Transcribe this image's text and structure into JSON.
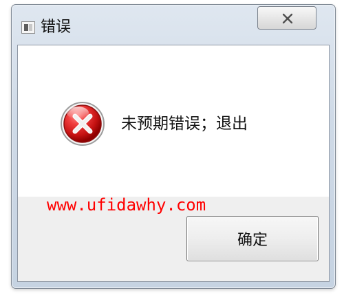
{
  "window": {
    "title": "错误",
    "close_icon": "close-icon",
    "title_icon": "app-icon"
  },
  "dialog": {
    "message": "未预期错误；退出",
    "ok_label": "确定",
    "error_icon": "error-icon"
  },
  "watermark": {
    "text": "www.ufidawhy.com",
    "color": "#ff0000"
  },
  "colors": {
    "accent": "#cc1111",
    "text": "#111111",
    "window_border": "#7d8793"
  }
}
